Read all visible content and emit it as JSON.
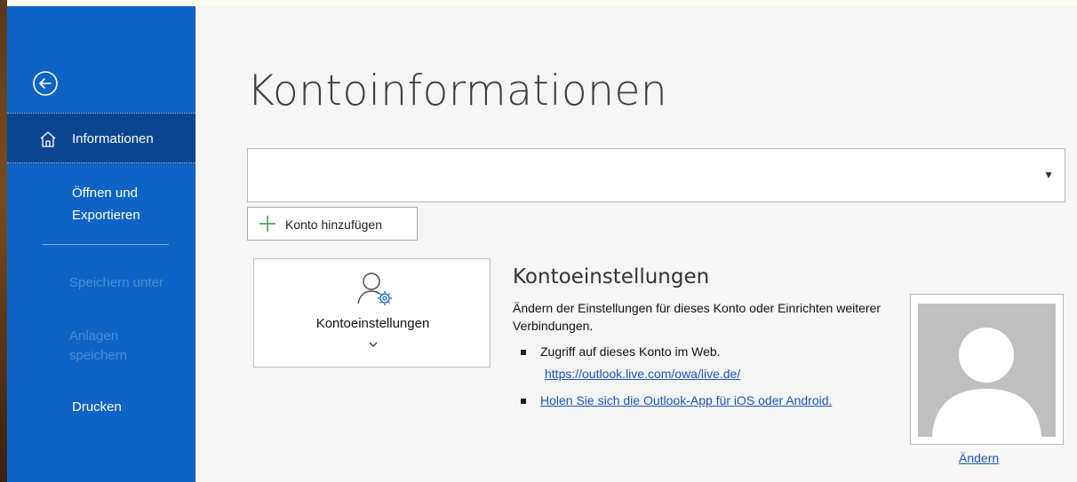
{
  "nav": {
    "info_label": "Informationen",
    "open_label": "Öffnen und\nExportieren",
    "save_as_label": "Speichern unter",
    "attachments_label": "Anlagen\nspeichern",
    "print_label": "Drucken"
  },
  "main": {
    "title": "Kontoinformationen",
    "account_selector_value": "",
    "add_account_label": "Konto hinzufügen",
    "settings_tile_label": "Kontoeinstellungen",
    "section_title": "Kontoeinstellungen",
    "section_description": "Ändern der Einstellungen für dieses Konto oder Einrichten weiterer Verbindungen.",
    "bullet_web_text": "Zugriff auf dieses Konto im Web.",
    "web_link": "https://outlook.live.com/owa/live.de/",
    "app_link": "Holen Sie sich die Outlook-App für iOS oder Android.",
    "change_photo_label": "Ändern"
  },
  "icons": {
    "back": "back-arrow-circle-icon",
    "home": "home-icon",
    "plus": "plus-icon",
    "settings": "person-gear-icon",
    "chevron": "chevron-down-icon",
    "caret": "dropdown-caret-icon"
  },
  "colors": {
    "nav_bg": "#0f63c4",
    "nav_selected": "#0a4690",
    "link": "#1a56b6",
    "accent_plus": "#2e9a3e"
  }
}
